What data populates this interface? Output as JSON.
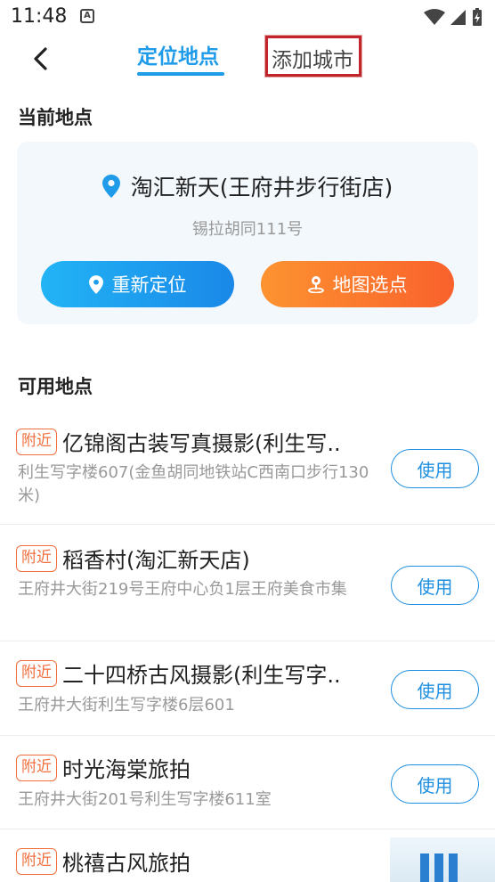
{
  "status_bar": {
    "time": "11:48",
    "notification_icon": "A"
  },
  "header": {
    "tab_active": "定位地点",
    "tab_city": "添加城市",
    "accent_color": "#1e9be9"
  },
  "current": {
    "section_title": "当前地点",
    "name": "淘汇新天(王府井步行街店)",
    "address": "锡拉胡同111号",
    "relocate_label": "重新定位",
    "map_label": "地图选点"
  },
  "available": {
    "section_title": "可用地点",
    "badge": "附近",
    "use_label": "使用",
    "items": [
      {
        "name": "亿锦阁古装写真摄影(利生写..",
        "address": "利生写字楼607(金鱼胡同地铁站C西南口步行130米)"
      },
      {
        "name": "稻香村(淘汇新天店)",
        "address": "王府井大街219号王府中心负1层王府美食市集"
      },
      {
        "name": "二十四桥古风摄影(利生写字..",
        "address": "王府井大街利生写字楼6层601"
      },
      {
        "name": "时光海棠旅拍",
        "address": "王府井大街201号利生写字楼611室"
      },
      {
        "name": "桃禧古风旅拍",
        "address": ""
      }
    ]
  }
}
